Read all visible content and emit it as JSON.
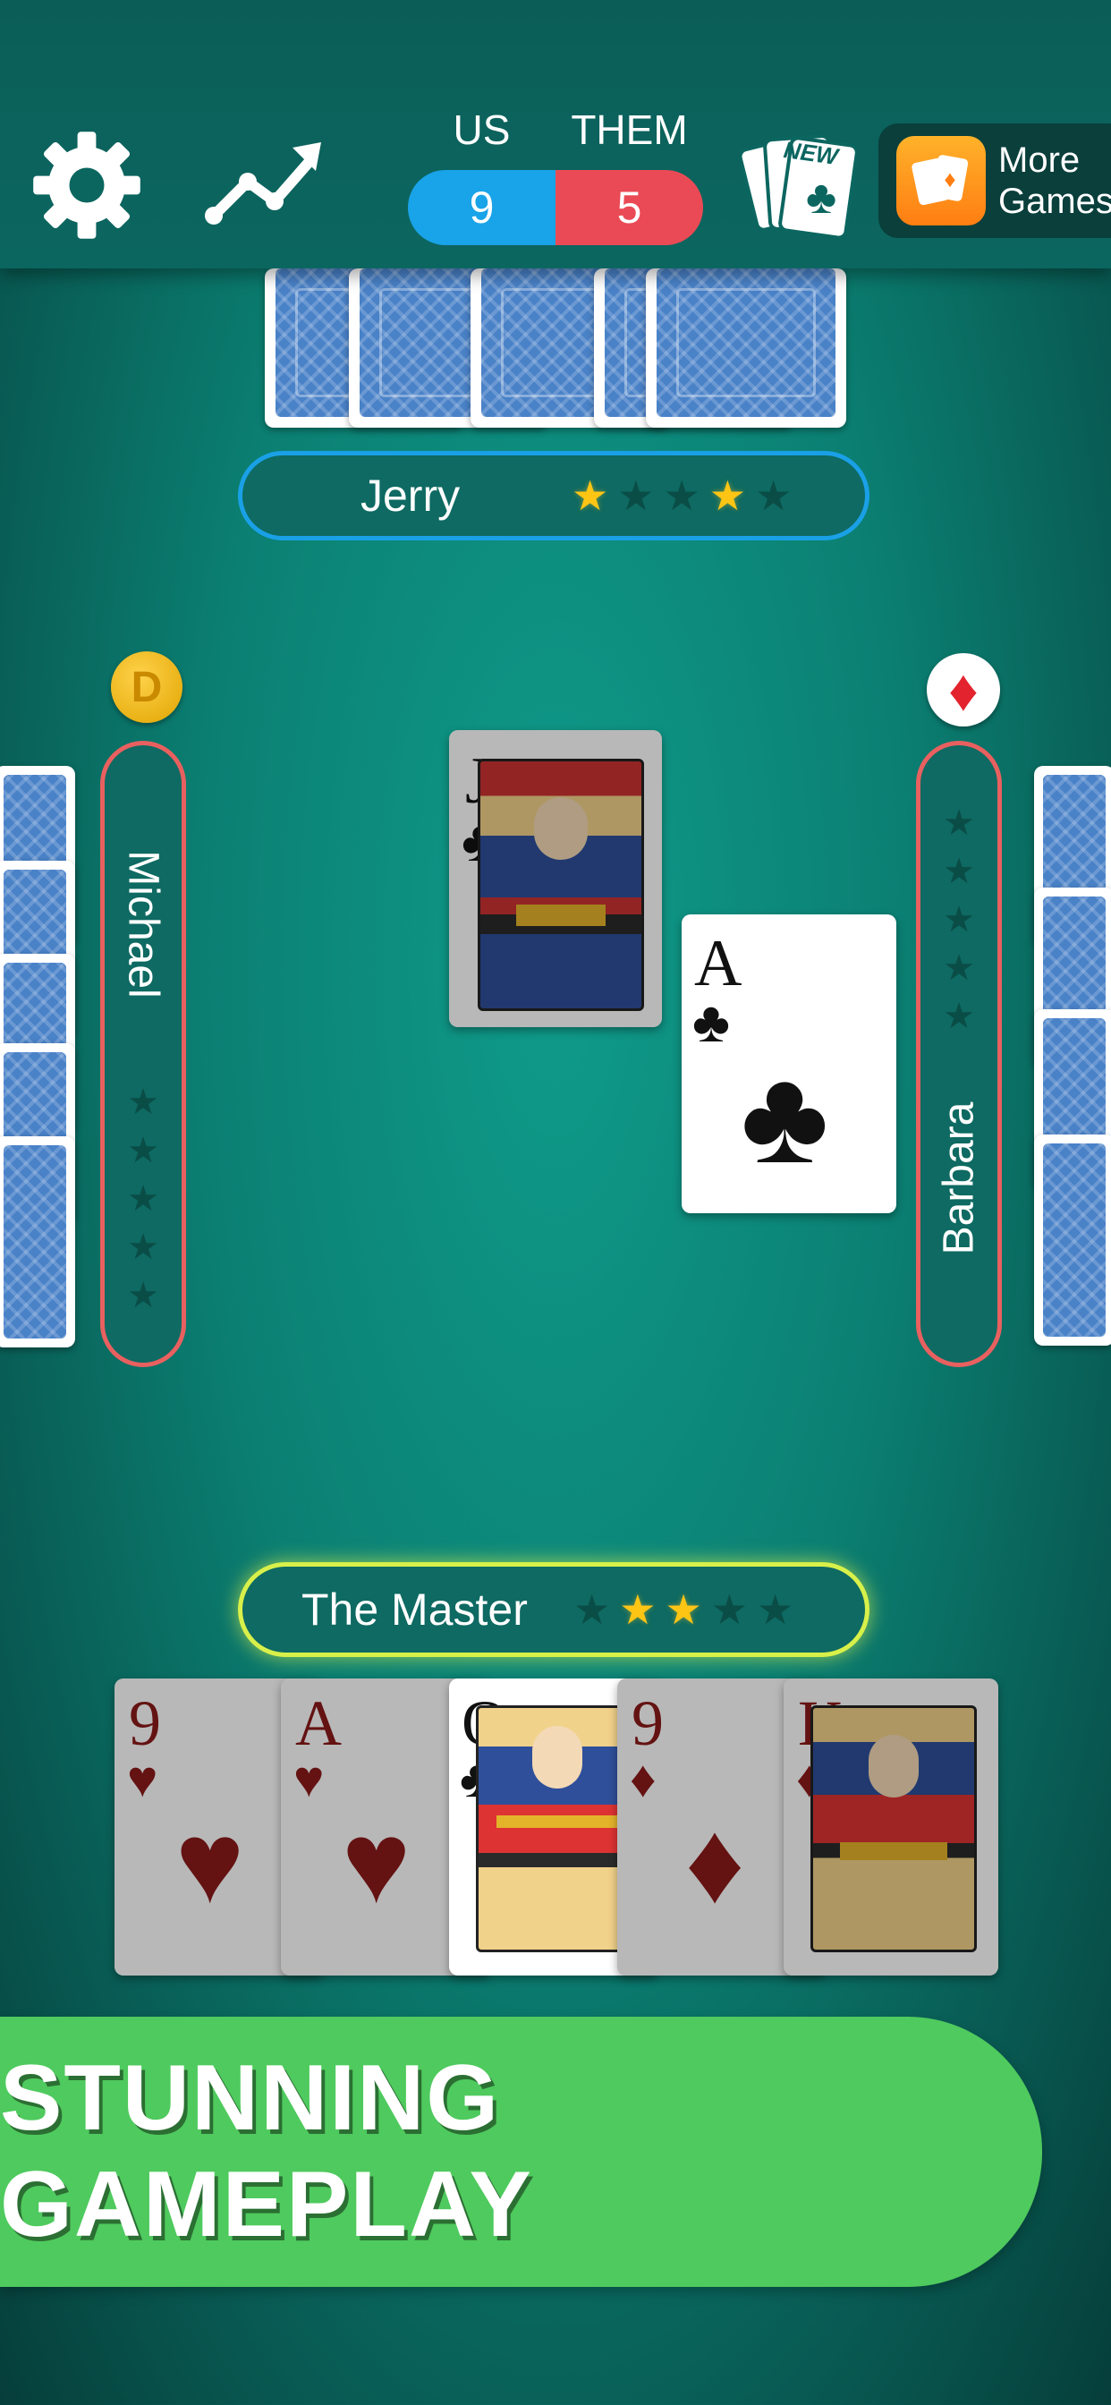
{
  "scoreboard": {
    "us_label": "US",
    "them_label": "THEM",
    "us_score": "9",
    "them_score": "5"
  },
  "toolbar": {
    "new_label": "NEW",
    "more_games_line1": "More",
    "more_games_line2": "Games"
  },
  "players": {
    "top": {
      "name": "Jerry",
      "stars": [
        true,
        false,
        false,
        true,
        false
      ]
    },
    "left": {
      "name": "Michael",
      "stars": [
        false,
        false,
        false,
        false,
        false
      ],
      "badge": "D"
    },
    "right": {
      "name": "Barbara",
      "stars": [
        false,
        false,
        false,
        false,
        false
      ]
    },
    "bottom": {
      "name": "The Master",
      "stars": [
        false,
        true,
        true,
        false,
        false
      ]
    }
  },
  "trick": {
    "card1": {
      "rank": "J",
      "suit": "♣"
    },
    "card2": {
      "rank": "A",
      "suit": "♣"
    }
  },
  "trump_suit": "♦",
  "hand": [
    {
      "rank": "9",
      "suit": "♥",
      "color": "#8b1a1a"
    },
    {
      "rank": "A",
      "suit": "♥",
      "color": "#8b1a1a"
    },
    {
      "rank": "Q",
      "suit": "♣",
      "color": "#111111"
    },
    {
      "rank": "9",
      "suit": "♦",
      "color": "#8b1a1a"
    },
    {
      "rank": "K",
      "suit": "♦",
      "color": "#8b1a1a"
    }
  ],
  "banner": {
    "text": "STUNNING GAMEPLAY"
  },
  "colors": {
    "us": "#19a3e8",
    "them": "#ea4a55",
    "star_on": "#ffc515",
    "banner": "#4fca5e"
  }
}
